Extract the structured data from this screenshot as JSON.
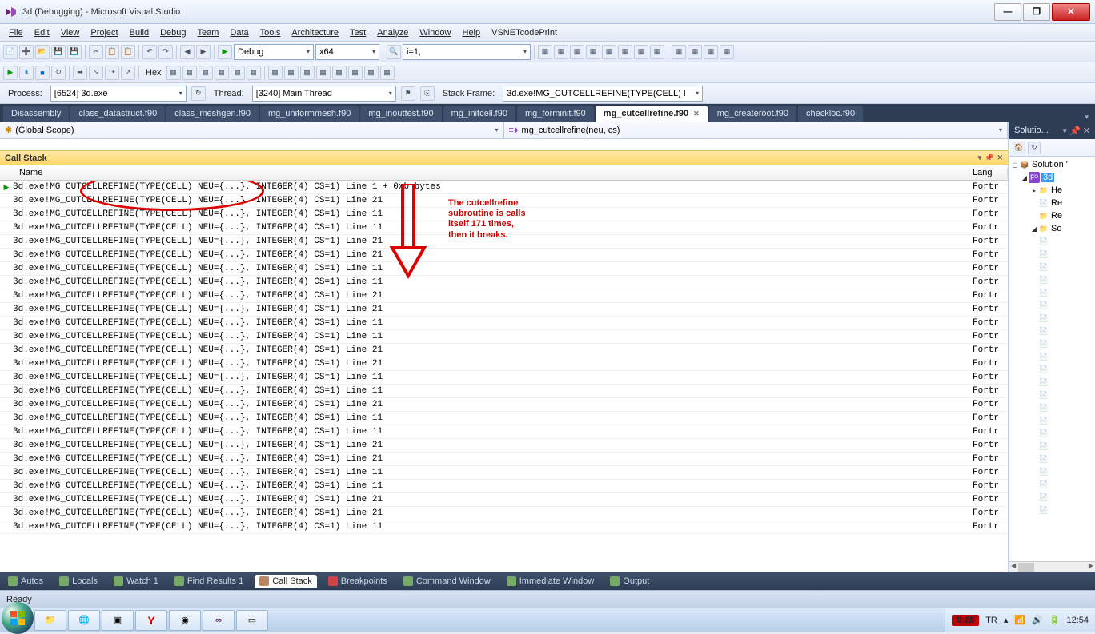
{
  "window": {
    "title": "3d (Debugging) - Microsoft Visual Studio",
    "min": "—",
    "max": "❐",
    "close": "✕"
  },
  "menu": [
    "File",
    "Edit",
    "View",
    "Project",
    "Build",
    "Debug",
    "Team",
    "Data",
    "Tools",
    "Architecture",
    "Test",
    "Analyze",
    "Window",
    "Help",
    "VSNETcodePrint"
  ],
  "toolbar1": {
    "config": "Debug",
    "platform": "x64",
    "search": "i=1,"
  },
  "toolbar2": {
    "process_label": "Process:",
    "process_value": "[6524] 3d.exe",
    "thread_label": "Thread:",
    "thread_value": "[3240] Main Thread",
    "stack_label": "Stack Frame:",
    "stack_value": "3d.exe!MG_CUTCELLREFINE(TYPE(CELL)  I"
  },
  "editor_tabs": [
    {
      "label": "Disassembly"
    },
    {
      "label": "class_datastruct.f90"
    },
    {
      "label": "class_meshgen.f90"
    },
    {
      "label": "mg_uniformmesh.f90"
    },
    {
      "label": "mg_inouttest.f90"
    },
    {
      "label": "mg_initcell.f90"
    },
    {
      "label": "mg_forminit.f90"
    },
    {
      "label": "mg_cutcellrefine.f90",
      "active": true
    },
    {
      "label": "mg_createroot.f90"
    },
    {
      "label": "checkloc.f90"
    }
  ],
  "scope": {
    "left": "(Global Scope)",
    "right": "mg_cutcellrefine(neu, cs)"
  },
  "callstack": {
    "title": "Call Stack",
    "col_name": "Name",
    "col_lang": "Lang",
    "lang": "Fortr",
    "top_row": "3d.exe!MG_CUTCELLREFINE(TYPE(CELL)  NEU={...}, INTEGER(4)  CS=1)  Line 1 + 0xb bytes",
    "rows": [
      "21",
      "11",
      "11",
      "21",
      "21",
      "11",
      "11",
      "21",
      "21",
      "11",
      "11",
      "21",
      "21",
      "11",
      "11",
      "21",
      "11",
      "11",
      "21",
      "21",
      "11",
      "11",
      "21",
      "21",
      "11"
    ]
  },
  "annotation": {
    "text1": "The cutcellrefine",
    "text2": "subroutine is calls",
    "text3": "itself 171 times,",
    "text4": "then it breaks."
  },
  "solution": {
    "title": "Solutio...",
    "root": "Solution '",
    "proj": "3d",
    "items": [
      "He",
      "Re",
      "Re",
      "So"
    ]
  },
  "bottom_tabs": [
    "Autos",
    "Locals",
    "Watch 1",
    "Find Results 1",
    "Call Stack",
    "Breakpoints",
    "Command Window",
    "Immediate Window",
    "Output"
  ],
  "status": "Ready",
  "taskbar": {
    "video": "0:28",
    "lang": "TR",
    "clock": "12:54"
  }
}
